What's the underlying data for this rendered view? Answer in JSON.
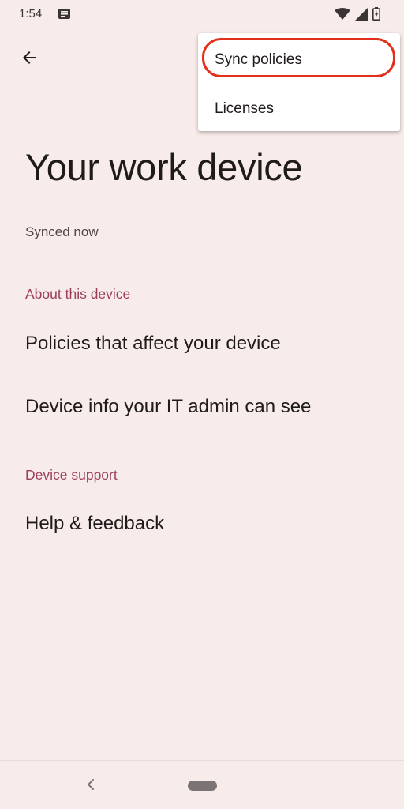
{
  "status_bar": {
    "time": "1:54",
    "icons": [
      "notification-icon",
      "wifi-icon",
      "signal-icon",
      "battery-charging-icon"
    ]
  },
  "app_bar": {
    "back_icon": "arrow-back-icon"
  },
  "page": {
    "title": "Your work device",
    "sync_status": "Synced now"
  },
  "sections": {
    "about": {
      "header": "About this device",
      "items": [
        "Policies that affect your device",
        "Device info your IT admin can see"
      ]
    },
    "support": {
      "header": "Device support",
      "items": [
        "Help & feedback"
      ]
    }
  },
  "overflow_menu": {
    "items": [
      "Sync policies",
      "Licenses"
    ],
    "highlighted": "Sync policies"
  },
  "colors": {
    "background": "#f8eceb",
    "section_header": "#9c3d5b",
    "highlight": "#e2311a"
  }
}
